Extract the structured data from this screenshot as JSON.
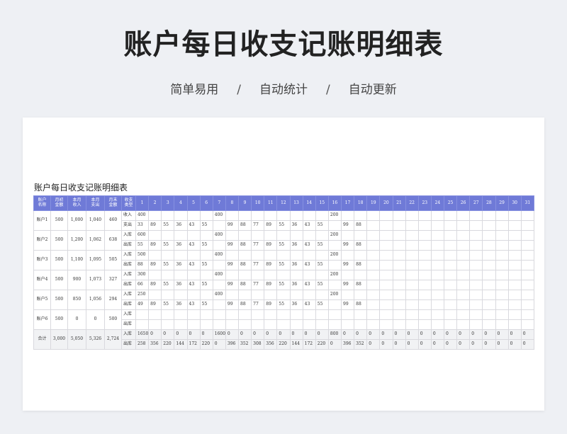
{
  "header": {
    "title": "账户每日收支记账明细表",
    "features": [
      "简单易用",
      "自动统计",
      "自动更新"
    ],
    "separator": "/"
  },
  "sheet": {
    "title": "账户每日收支记账明细表",
    "columns": {
      "account": [
        "账户",
        "名称"
      ],
      "opening": [
        "月初",
        "金额"
      ],
      "income": [
        "本月",
        "收入"
      ],
      "expense": [
        "本月",
        "支出"
      ],
      "closing": [
        "月末",
        "金额"
      ],
      "type": [
        "收支",
        "类型"
      ],
      "days": [
        "1",
        "2",
        "3",
        "4",
        "5",
        "6",
        "7",
        "8",
        "9",
        "10",
        "11",
        "12",
        "13",
        "14",
        "15",
        "16",
        "17",
        "18",
        "19",
        "20",
        "21",
        "22",
        "23",
        "24",
        "25",
        "26",
        "27",
        "28",
        "29",
        "30",
        "31"
      ]
    },
    "accounts": [
      {
        "name": "账户1",
        "opening": "500",
        "income": "1,000",
        "expense": "1,040",
        "closing": "460",
        "rows": [
          {
            "type": "收入",
            "days": [
              "400",
              "",
              "",
              "",
              "",
              "",
              "400",
              "",
              "",
              "",
              "",
              "",
              "",
              "",
              "",
              "200",
              "",
              "",
              "",
              "",
              "",
              "",
              "",
              "",
              "",
              "",
              "",
              "",
              "",
              "",
              ""
            ]
          },
          {
            "type": "支出",
            "days": [
              "33",
              "89",
              "55",
              "36",
              "43",
              "55",
              "",
              "99",
              "88",
              "77",
              "89",
              "55",
              "36",
              "43",
              "55",
              "",
              "99",
              "88",
              "",
              "",
              "",
              "",
              "",
              "",
              "",
              "",
              "",
              "",
              "",
              "",
              ""
            ]
          }
        ]
      },
      {
        "name": "账户2",
        "opening": "500",
        "income": "1,200",
        "expense": "1,062",
        "closing": "638",
        "rows": [
          {
            "type": "入库",
            "days": [
              "600",
              "",
              "",
              "",
              "",
              "",
              "400",
              "",
              "",
              "",
              "",
              "",
              "",
              "",
              "",
              "200",
              "",
              "",
              "",
              "",
              "",
              "",
              "",
              "",
              "",
              "",
              "",
              "",
              "",
              "",
              ""
            ]
          },
          {
            "type": "出库",
            "days": [
              "55",
              "89",
              "55",
              "36",
              "43",
              "55",
              "",
              "99",
              "88",
              "77",
              "89",
              "55",
              "36",
              "43",
              "55",
              "",
              "99",
              "88",
              "",
              "",
              "",
              "",
              "",
              "",
              "",
              "",
              "",
              "",
              "",
              "",
              ""
            ]
          }
        ]
      },
      {
        "name": "账户3",
        "opening": "500",
        "income": "1,100",
        "expense": "1,095",
        "closing": "505",
        "rows": [
          {
            "type": "入库",
            "days": [
              "500",
              "",
              "",
              "",
              "",
              "",
              "400",
              "",
              "",
              "",
              "",
              "",
              "",
              "",
              "",
              "200",
              "",
              "",
              "",
              "",
              "",
              "",
              "",
              "",
              "",
              "",
              "",
              "",
              "",
              "",
              ""
            ]
          },
          {
            "type": "出库",
            "days": [
              "88",
              "89",
              "55",
              "36",
              "43",
              "55",
              "",
              "99",
              "88",
              "77",
              "89",
              "55",
              "36",
              "43",
              "55",
              "",
              "99",
              "88",
              "",
              "",
              "",
              "",
              "",
              "",
              "",
              "",
              "",
              "",
              "",
              "",
              ""
            ]
          }
        ]
      },
      {
        "name": "账户4",
        "opening": "500",
        "income": "900",
        "expense": "1,073",
        "closing": "327",
        "rows": [
          {
            "type": "入库",
            "days": [
              "300",
              "",
              "",
              "",
              "",
              "",
              "400",
              "",
              "",
              "",
              "",
              "",
              "",
              "",
              "",
              "200",
              "",
              "",
              "",
              "",
              "",
              "",
              "",
              "",
              "",
              "",
              "",
              "",
              "",
              "",
              ""
            ]
          },
          {
            "type": "出库",
            "days": [
              "66",
              "89",
              "55",
              "36",
              "43",
              "55",
              "",
              "99",
              "88",
              "77",
              "89",
              "55",
              "36",
              "43",
              "55",
              "",
              "99",
              "88",
              "",
              "",
              "",
              "",
              "",
              "",
              "",
              "",
              "",
              "",
              "",
              "",
              ""
            ]
          }
        ]
      },
      {
        "name": "账户5",
        "opening": "500",
        "income": "850",
        "expense": "1,056",
        "closing": "294",
        "rows": [
          {
            "type": "入库",
            "days": [
              "250",
              "",
              "",
              "",
              "",
              "",
              "400",
              "",
              "",
              "",
              "",
              "",
              "",
              "",
              "",
              "200",
              "",
              "",
              "",
              "",
              "",
              "",
              "",
              "",
              "",
              "",
              "",
              "",
              "",
              "",
              ""
            ]
          },
          {
            "type": "出库",
            "days": [
              "49",
              "89",
              "55",
              "36",
              "43",
              "55",
              "",
              "99",
              "88",
              "77",
              "89",
              "55",
              "36",
              "43",
              "55",
              "",
              "99",
              "88",
              "",
              "",
              "",
              "",
              "",
              "",
              "",
              "",
              "",
              "",
              "",
              "",
              ""
            ]
          }
        ]
      },
      {
        "name": "账户6",
        "opening": "500",
        "income": "0",
        "expense": "0",
        "closing": "500",
        "rows": [
          {
            "type": "入库",
            "days": [
              "",
              "",
              "",
              "",
              "",
              "",
              "",
              "",
              "",
              "",
              "",
              "",
              "",
              "",
              "",
              "",
              "",
              "",
              "",
              "",
              "",
              "",
              "",
              "",
              "",
              "",
              "",
              "",
              "",
              "",
              ""
            ]
          },
          {
            "type": "出库",
            "days": [
              "",
              "",
              "",
              "",
              "",
              "",
              "",
              "",
              "",
              "",
              "",
              "",
              "",
              "",
              "",
              "",
              "",
              "",
              "",
              "",
              "",
              "",
              "",
              "",
              "",
              "",
              "",
              "",
              "",
              "",
              ""
            ]
          }
        ]
      }
    ],
    "total": {
      "name": "合计",
      "opening": "3,000",
      "income": "5,050",
      "expense": "5,326",
      "closing": "2,724",
      "rows": [
        {
          "type": "入库",
          "days": [
            "1650",
            "0",
            "0",
            "0",
            "0",
            "0",
            "1600",
            "0",
            "0",
            "0",
            "0",
            "0",
            "0",
            "0",
            "0",
            "800",
            "0",
            "0",
            "0",
            "0",
            "0",
            "0",
            "0",
            "0",
            "0",
            "0",
            "0",
            "0",
            "0",
            "0",
            "0"
          ]
        },
        {
          "type": "出库",
          "days": [
            "258",
            "356",
            "220",
            "144",
            "172",
            "220",
            "0",
            "396",
            "352",
            "308",
            "356",
            "220",
            "144",
            "172",
            "220",
            "0",
            "396",
            "352",
            "0",
            "0",
            "0",
            "0",
            "0",
            "0",
            "0",
            "0",
            "0",
            "0",
            "0",
            "0",
            "0"
          ]
        }
      ]
    }
  }
}
